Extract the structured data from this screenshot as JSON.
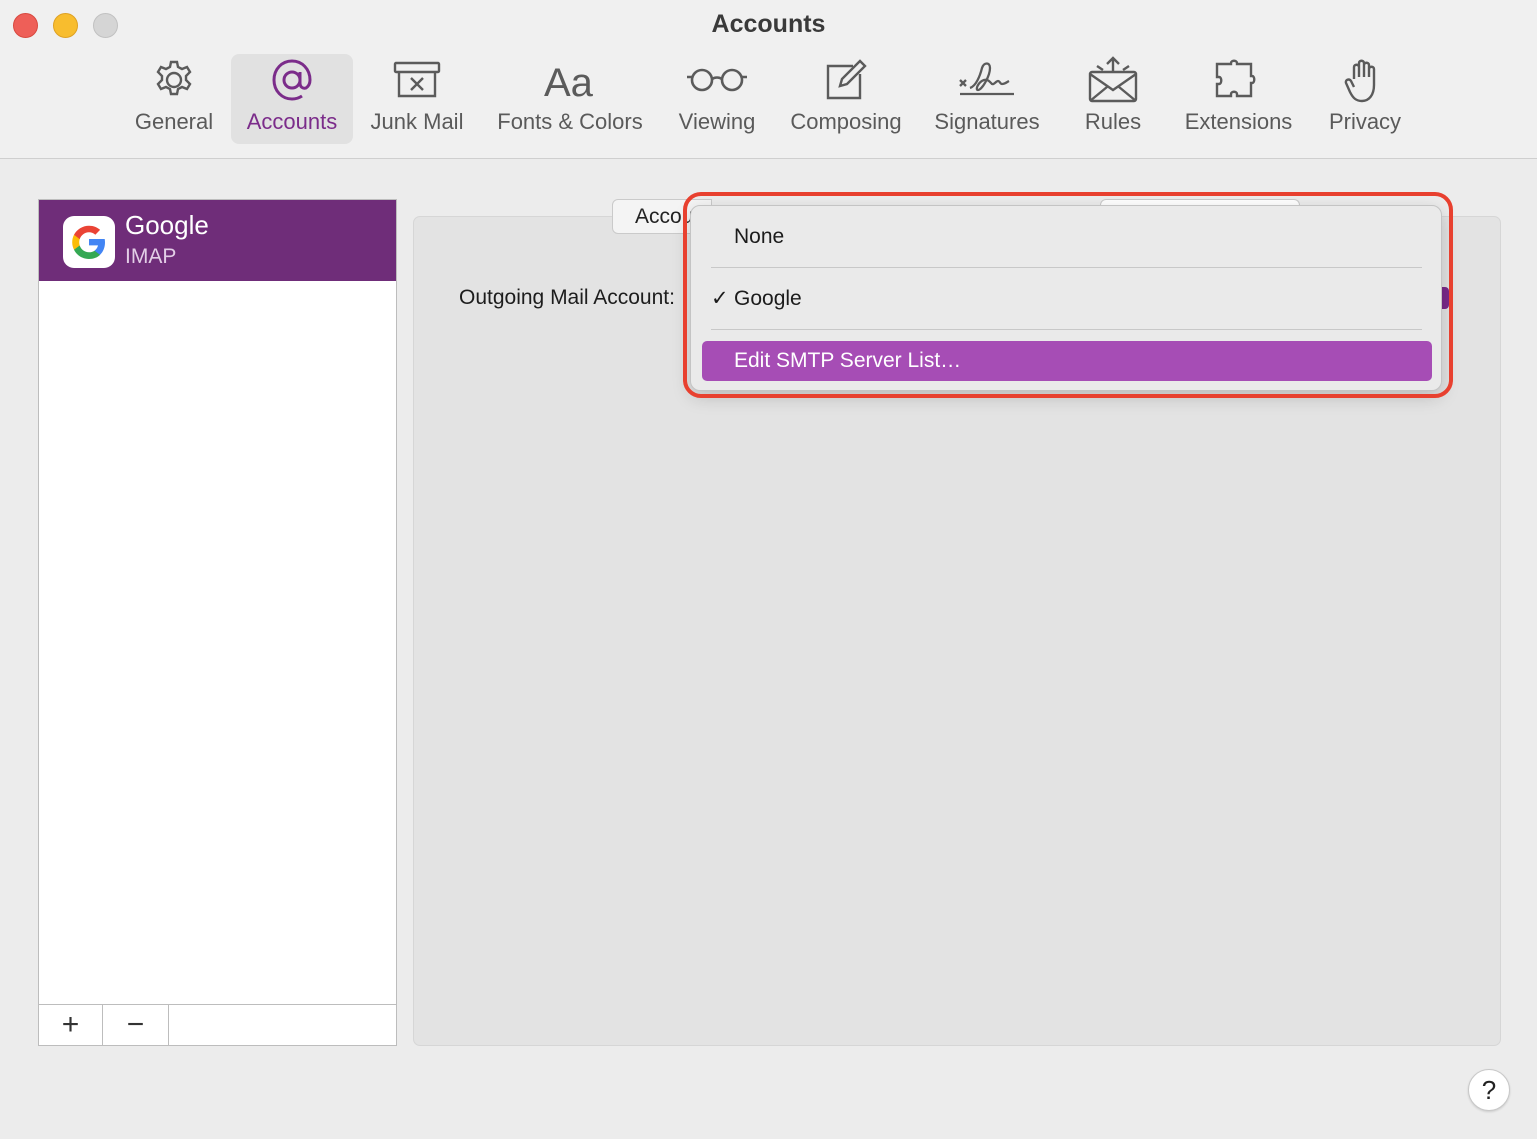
{
  "window": {
    "title": "Accounts"
  },
  "toolbar": {
    "items": [
      {
        "label": "General",
        "icon": "gear-icon"
      },
      {
        "label": "Accounts",
        "icon": "at-sign-icon",
        "active": true
      },
      {
        "label": "Junk Mail",
        "icon": "junk-mail-icon"
      },
      {
        "label": "Fonts & Colors",
        "icon": "font-aa-icon"
      },
      {
        "label": "Viewing",
        "icon": "glasses-icon"
      },
      {
        "label": "Composing",
        "icon": "compose-icon"
      },
      {
        "label": "Signatures",
        "icon": "signature-icon"
      },
      {
        "label": "Rules",
        "icon": "rules-envelope-icon"
      },
      {
        "label": "Extensions",
        "icon": "puzzle-icon"
      },
      {
        "label": "Privacy",
        "icon": "hand-icon"
      }
    ]
  },
  "accounts": {
    "items": [
      {
        "name": "Google",
        "type": "IMAP",
        "icon": "google-logo-icon",
        "selected": true
      }
    ],
    "add_label": "+",
    "remove_label": "−"
  },
  "panel": {
    "tab_label": "Account Information",
    "outgoing_label": "Outgoing Mail Account:"
  },
  "menu": {
    "items": [
      {
        "label": "None"
      },
      {
        "label": "Google",
        "checked": true,
        "check": "✓"
      },
      {
        "label": "Edit SMTP Server List…",
        "highlighted": true
      }
    ]
  },
  "help": {
    "label": "?"
  },
  "colors": {
    "accent": "#6f2d79",
    "menu_highlight": "#a64db5",
    "annotation_ring": "#e8402f"
  }
}
